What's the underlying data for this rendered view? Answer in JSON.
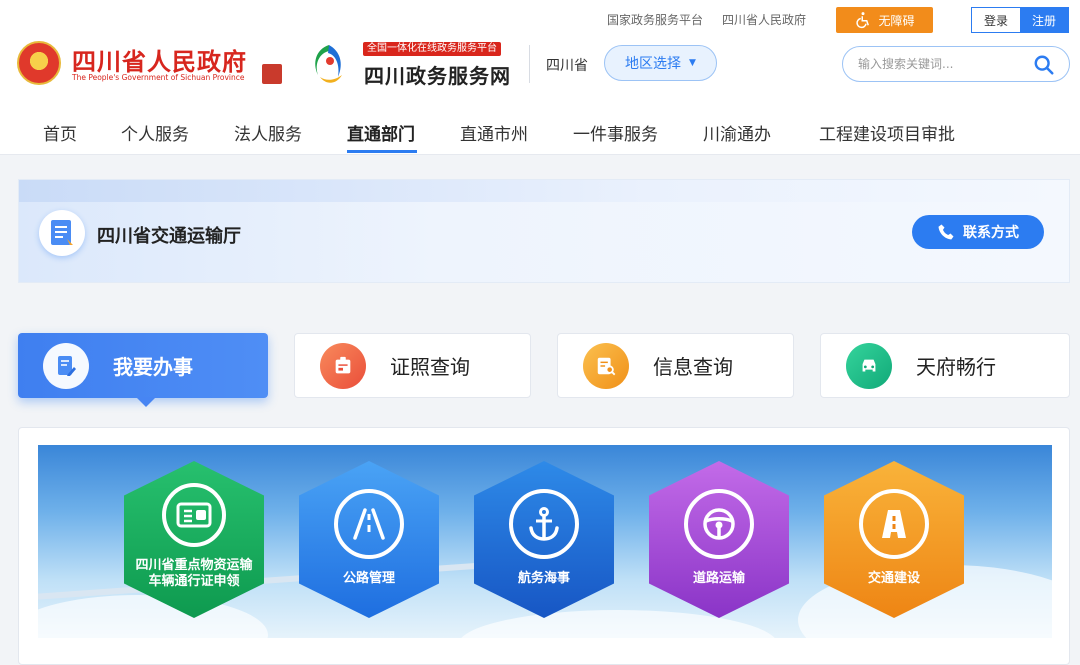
{
  "top_links": [
    "国家政务服务平台",
    "四川省人民政府"
  ],
  "accessibility": {
    "label": "无障碍"
  },
  "auth": {
    "login": "登录",
    "register": "注册"
  },
  "gov": {
    "title": "四川省人民政府",
    "subtitle": "The People's Government of Sichuan Province"
  },
  "portal": {
    "tag": "全国一体化在线政务服务平台",
    "title": "四川政务服务网"
  },
  "region": {
    "province": "四川省",
    "select_label": "地区选择"
  },
  "search": {
    "placeholder": "输入搜索关键词..."
  },
  "nav": [
    "首页",
    "个人服务",
    "法人服务",
    "直通部门",
    "直通市州",
    "一件事服务",
    "川渝通办",
    "工程建设项目审批"
  ],
  "nav_active": "直通部门",
  "department": {
    "name": "四川省交通运输厅",
    "contact_label": "联系方式"
  },
  "tabs": [
    {
      "label": "我要办事",
      "icon": "edit-document-icon",
      "color": "#ffffff",
      "active": true
    },
    {
      "label": "证照查询",
      "icon": "certificate-icon",
      "color": "#f06a4c",
      "active": false
    },
    {
      "label": "信息查询",
      "icon": "search-document-icon",
      "color": "#f3a12a",
      "active": false
    },
    {
      "label": "天府畅行",
      "icon": "car-icon",
      "color": "#1fc08c",
      "active": false
    }
  ],
  "services": [
    {
      "label": "四川省重点物资运输车辆通行证申领",
      "icon": "vehicle-pass-icon",
      "color_top": "#27c06e",
      "color_bottom": "#0e9a4f"
    },
    {
      "label": "公路管理",
      "icon": "road-icon",
      "color_top": "#4aa3f5",
      "color_bottom": "#1e6ee0"
    },
    {
      "label": "航务海事",
      "icon": "anchor-icon",
      "color_top": "#2e8ae8",
      "color_bottom": "#1756c4"
    },
    {
      "label": "道路运输",
      "icon": "steering-wheel-icon",
      "color_top": "#c36be8",
      "color_bottom": "#8a34c7"
    },
    {
      "label": "交通建设",
      "icon": "highway-icon",
      "color_top": "#f9b33a",
      "color_bottom": "#ee8514"
    }
  ]
}
